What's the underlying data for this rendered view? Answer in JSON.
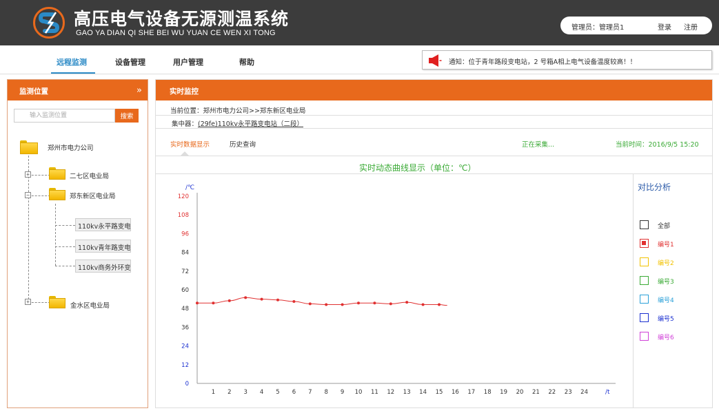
{
  "header": {
    "title_cn": "高压电气设备无源测温系统",
    "title_en": "GAO YA  DIAN QI SHE BEI WU YUAN CE WEN XI TONG",
    "user_label": "管理员：管理员1",
    "login": "登录",
    "register": "注册",
    "brand_color": "#e8691c"
  },
  "nav": {
    "tabs": [
      "远程监测",
      "设备管理",
      "用户管理",
      "帮助"
    ],
    "active_tab": "远程监测",
    "notice_icon": "megaphone-icon",
    "notice": "通知：位于青年路段变电站，2 号箱A相上电气设备温度较高！！"
  },
  "left": {
    "title": "监测位置",
    "search_placeholder": "输入监测位置",
    "search_button": "搜索",
    "tree": {
      "root": "郑州市电力公司",
      "nodes": [
        {
          "label": "二七区电业局",
          "toggle": "+"
        },
        {
          "label": "郑东新区电业局",
          "toggle": "−",
          "children": [
            "110kv永平路变电站",
            "110kv青年路变电站",
            "110kv商务外环变电站"
          ]
        },
        {
          "label": "金水区电业局",
          "toggle": "+"
        }
      ]
    }
  },
  "right": {
    "title": "实时监控",
    "breadcrumb": "当前位置：郑州市电力公司>>郑东新区电业局",
    "collector_label": "集中器：",
    "collector_value": "(29fe)110kv永平路变电站（二段）",
    "subtabs": [
      "实时数据显示",
      "历史查询"
    ],
    "status": "正在采集...",
    "current_time": "当前时间：2016/9/5    15:20",
    "chart_title": "实时动态曲线显示（单位：℃）",
    "compare": {
      "title": "对比分析",
      "items": [
        {
          "label": "全部",
          "color": "#333333"
        },
        {
          "label": "编号1",
          "color": "#e03030",
          "checked": true
        },
        {
          "label": "编号2",
          "color": "#f2c200"
        },
        {
          "label": "编号3",
          "color": "#3aaa35"
        },
        {
          "label": "编号4",
          "color": "#2aa0d8"
        },
        {
          "label": "编号5",
          "color": "#1a2fd0"
        },
        {
          "label": "编号6",
          "color": "#d040d8"
        }
      ]
    }
  },
  "chart_data": {
    "type": "line",
    "y_unit": "/℃",
    "x_unit": "/t",
    "ylim": [
      0,
      120
    ],
    "y_ticks": [
      0,
      12,
      24,
      36,
      48,
      60,
      72,
      84,
      96,
      108,
      120
    ],
    "y_tick_colors": [
      "#1a2fd0",
      "#1a2fd0",
      "#1a2fd0",
      "#333333",
      "#333333",
      "#333333",
      "#333333",
      "#333333",
      "#e03030",
      "#e03030",
      "#e03030"
    ],
    "x_ticks": [
      1,
      2,
      3,
      4,
      5,
      6,
      7,
      8,
      9,
      10,
      11,
      12,
      13,
      14,
      15,
      16,
      17,
      18,
      19,
      20,
      21,
      22,
      23,
      24
    ],
    "series": [
      {
        "name": "编号1",
        "color": "#e03030",
        "x": [
          0,
          1,
          2,
          3,
          4,
          5,
          6,
          7,
          8,
          9,
          10,
          11,
          12,
          13,
          14,
          15,
          15.5
        ],
        "values": [
          51.5,
          51.5,
          53,
          55,
          54,
          53.5,
          52.5,
          51,
          50.5,
          50.5,
          51.5,
          51.5,
          51,
          52,
          50.5,
          50.5,
          50
        ]
      }
    ]
  }
}
